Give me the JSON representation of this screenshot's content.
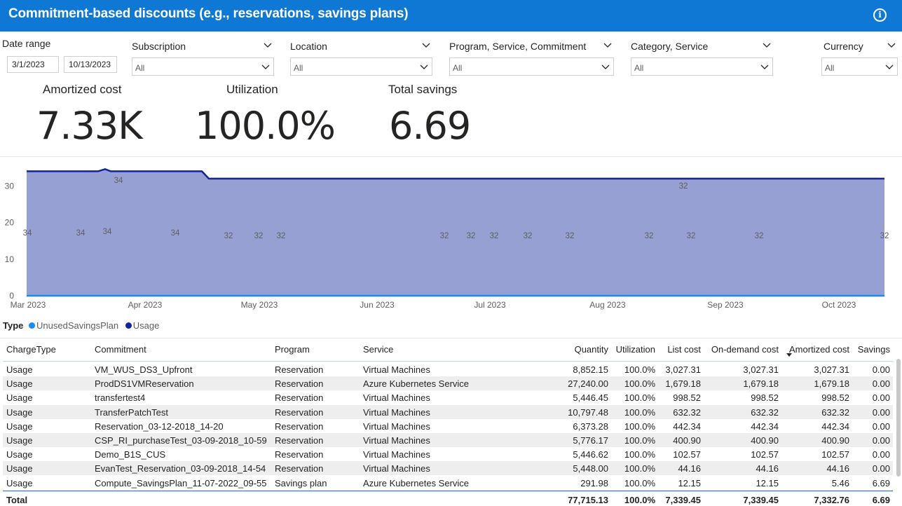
{
  "header": {
    "title": "Commitment-based discounts (e.g., reservations, savings plans)",
    "info_icon": "info-icon"
  },
  "filters": {
    "date_range": {
      "label": "Date range",
      "start": "3/1/2023",
      "end": "10/13/2023"
    },
    "subscription": {
      "label": "Subscription",
      "value": "All"
    },
    "location": {
      "label": "Location",
      "value": "All"
    },
    "program": {
      "label": "Program, Service, Commitment",
      "value": "All"
    },
    "category": {
      "label": "Category, Service",
      "value": "All"
    },
    "currency": {
      "label": "Currency",
      "value": "All"
    }
  },
  "kpis": {
    "amortized": {
      "label": "Amortized cost",
      "value": "7.33K"
    },
    "utilization": {
      "label": "Utilization",
      "value": "100.0%"
    },
    "savings": {
      "label": "Total savings",
      "value": "6.69"
    }
  },
  "chart_data": {
    "type": "area",
    "x_ticks": [
      "Mar 2023",
      "Apr 2023",
      "May 2023",
      "Jun 2023",
      "Jul 2023",
      "Aug 2023",
      "Sep 2023",
      "Oct 2023"
    ],
    "y_ticks": [
      "0",
      "10",
      "20",
      "30"
    ],
    "ylim": [
      0,
      36
    ],
    "series": [
      {
        "name": "UnusedSavingsPlan",
        "color": "#118dff",
        "values": [
          0,
          0
        ]
      },
      {
        "name": "Usage",
        "color": "#12239e",
        "fill": "#96a0d3",
        "values": [
          34,
          34,
          34,
          34.6,
          34,
          34,
          34,
          32,
          32,
          32,
          32,
          32,
          32,
          32,
          32,
          32,
          32,
          32
        ]
      }
    ],
    "data_labels": [
      "34",
      "34",
      "34",
      "34",
      "34",
      "32",
      "32",
      "32",
      "32",
      "32",
      "32",
      "32",
      "32",
      "32",
      "32",
      "32",
      "32",
      "32"
    ],
    "legend_title": "Type",
    "legend_position": "bottom-left"
  },
  "table": {
    "columns": [
      "ChargeType",
      "Commitment",
      "Program",
      "Service",
      "Quantity",
      "Utilization",
      "List cost",
      "On-demand cost",
      "Amortized cost",
      "Savings"
    ],
    "rows": [
      [
        "Usage",
        "VM_WUS_DS3_Upfront",
        "Reservation",
        "Virtual Machines",
        "8,852.15",
        "100.0%",
        "3,027.31",
        "3,027.31",
        "3,027.31",
        "0.00"
      ],
      [
        "Usage",
        "ProdDS1VMReservation",
        "Reservation",
        "Azure Kubernetes Service",
        "27,240.00",
        "100.0%",
        "1,679.18",
        "1,679.18",
        "1,679.18",
        "0.00"
      ],
      [
        "Usage",
        "transfertest4",
        "Reservation",
        "Virtual Machines",
        "5,446.45",
        "100.0%",
        "998.52",
        "998.52",
        "998.52",
        "0.00"
      ],
      [
        "Usage",
        "TransferPatchTest",
        "Reservation",
        "Virtual Machines",
        "10,797.48",
        "100.0%",
        "632.32",
        "632.32",
        "632.32",
        "0.00"
      ],
      [
        "Usage",
        "Reservation_03-12-2018_14-20",
        "Reservation",
        "Virtual Machines",
        "6,373.28",
        "100.0%",
        "442.34",
        "442.34",
        "442.34",
        "0.00"
      ],
      [
        "Usage",
        "CSP_RI_purchaseTest_03-09-2018_10-59",
        "Reservation",
        "Virtual Machines",
        "5,776.17",
        "100.0%",
        "400.90",
        "400.90",
        "400.90",
        "0.00"
      ],
      [
        "Usage",
        "Demo_B1S_CUS",
        "Reservation",
        "Virtual Machines",
        "5,446.62",
        "100.0%",
        "102.57",
        "102.57",
        "102.57",
        "0.00"
      ],
      [
        "Usage",
        "EvanTest_Reservation_03-09-2018_14-54",
        "Reservation",
        "Virtual Machines",
        "5,448.00",
        "100.0%",
        "44.16",
        "44.16",
        "44.16",
        "0.00"
      ],
      [
        "Usage",
        "Compute_SavingsPlan_11-07-2022_09-55",
        "Savings plan",
        "Azure Kubernetes Service",
        "291.98",
        "100.0%",
        "12.15",
        "12.15",
        "5.46",
        "6.69"
      ]
    ],
    "total": {
      "label": "Total",
      "quantity": "77,715.13",
      "utilization": "100.0%",
      "list": "7,339.45",
      "ondemand": "7,339.45",
      "amortized": "7,332.76",
      "savings": "6.69"
    }
  }
}
